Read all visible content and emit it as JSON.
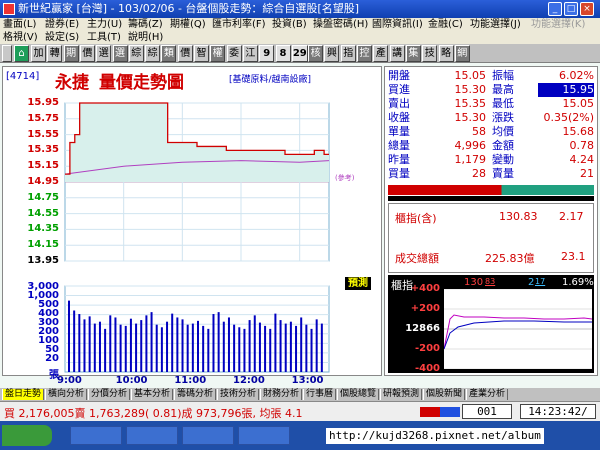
{
  "window": {
    "title": "新世紀贏家 [台灣] - 103/02/06 - 台盤個股走勢：綜合自選股[名望股]",
    "min": "_",
    "max": "□",
    "close": "×"
  },
  "menu": {
    "row1": [
      {
        "label": "畫面(L)",
        "enabled": true
      },
      {
        "label": "證券(E)",
        "enabled": true
      },
      {
        "label": "主力(U)",
        "enabled": true
      },
      {
        "label": "籌碼(Z)",
        "enabled": true
      },
      {
        "label": "期權(Q)",
        "enabled": true
      },
      {
        "label": "匯市利率(F)",
        "enabled": true
      },
      {
        "label": "投資(B)",
        "enabled": true
      },
      {
        "label": "操盤密碼(H)",
        "enabled": true
      },
      {
        "label": "國際資訊(I)",
        "enabled": true
      },
      {
        "label": "金融(C)",
        "enabled": true
      },
      {
        "label": "功能選擇(J)",
        "enabled": true
      },
      {
        "label": "功能選擇(K)",
        "enabled": false
      }
    ],
    "row2": [
      {
        "label": "格視(V)"
      },
      {
        "label": "設定(S)"
      },
      {
        "label": "工具(T)"
      },
      {
        "label": "說明(H)"
      }
    ]
  },
  "toolbar": {
    "home_icon": "home-icon",
    "buttons": [
      "加",
      "轉",
      "期",
      "價",
      "選",
      "選",
      "綜",
      "綜",
      "類",
      "價",
      "智",
      "權",
      "委",
      "江",
      "9",
      "8",
      "29",
      "核",
      "興",
      "指",
      "控",
      "產",
      "講",
      "集",
      "技",
      "略",
      "網"
    ]
  },
  "stock": {
    "code": "[4714]",
    "name": "永捷",
    "chart_title": "量價走勢圖",
    "subtitle": "[基礎原料/越南設廠]"
  },
  "price_axis": {
    "ticks": [
      "15.95",
      "15.75",
      "15.55",
      "15.35",
      "15.15",
      "14.95",
      "14.75",
      "14.55",
      "14.35",
      "14.15",
      "13.95"
    ],
    "base_label": "(參考)"
  },
  "volume_axis": {
    "ticks": [
      "3,000",
      "1,000",
      "500",
      "400",
      "300",
      "200",
      "100",
      "50",
      "20"
    ],
    "unit": "張"
  },
  "time_axis": [
    "9:00",
    "10:00",
    "11:00",
    "12:00",
    "13:00"
  ],
  "predict_button": "預測",
  "quote": {
    "rows": [
      {
        "l1": "開盤",
        "v1": "15.05",
        "l2": "振幅",
        "v2": "6.02%",
        "c1": "#d00000",
        "c2": "#d00000"
      },
      {
        "l1": "買進",
        "v1": "15.30",
        "l2": "最高",
        "v2": "15.95",
        "c1": "#d00000",
        "c2": "#ffffff"
      },
      {
        "l1": "賣出",
        "v1": "15.35",
        "l2": "最低",
        "v2": "15.05",
        "c1": "#d00000",
        "c2": "#d00000"
      },
      {
        "l1": "收盤",
        "v1": "15.30",
        "l2": "漲跌",
        "v2": "0.35(2%)",
        "c1": "#d00000",
        "c2": "#d00000"
      },
      {
        "l1": "單量",
        "v1": "58",
        "l2": "均價",
        "v2": "15.68",
        "c1": "#d00000",
        "c2": "#d00000"
      },
      {
        "l1": "總量",
        "v1": "4,996",
        "l2": "金額",
        "v2": "0.78",
        "c1": "#d00000",
        "c2": "#d00000"
      },
      {
        "l1": "昨量",
        "v1": "1,179",
        "l2": "變動",
        "v2": "4.24",
        "c1": "#d00000",
        "c2": "#d00000"
      },
      {
        "l1": "買量",
        "v1": "28",
        "l2": "賣量",
        "v2": "21",
        "c1": "#d00000",
        "c2": "#d00000"
      }
    ],
    "high_highlight_color": "#0000c0"
  },
  "index_box": {
    "label": "櫃指(含)",
    "value": "130.83",
    "change": "2.17",
    "amount_label": "成交總額",
    "amount": "225.83億",
    "amount_change": "23.1"
  },
  "mini_chart": {
    "label": "櫃指",
    "value": "130",
    "value_sub": "83",
    "up_count": "2",
    "up_count_sub": "17",
    "pct": "1.69%",
    "ticks": [
      "+400",
      "+200",
      "12866",
      "-200",
      "-400"
    ]
  },
  "tabs": [
    {
      "label": "盤日走勢",
      "active": true
    },
    {
      "label": "橫向分析",
      "active": false
    },
    {
      "label": "分價分析",
      "active": false
    },
    {
      "label": "基本分析",
      "active": false
    },
    {
      "label": "籌碼分析",
      "active": false
    },
    {
      "label": "技術分析",
      "active": false
    },
    {
      "label": "財務分析",
      "active": false
    },
    {
      "label": "行事曆",
      "active": false
    },
    {
      "label": "個股總覽",
      "active": false
    },
    {
      "label": "研報預測",
      "active": false
    },
    {
      "label": "個股新聞",
      "active": false
    },
    {
      "label": "產業分析",
      "active": false
    }
  ],
  "status": {
    "text": "買 2,176,005賣 1,763,289( 0.81)成 973,796張, 均張 4.1",
    "page": "001",
    "time": "14:23:42/"
  },
  "taskbar": {
    "watermark": "http://kujd3268.pixnet.net/album"
  },
  "colors": {
    "price_line": "#d00000",
    "avg_line": "#b040c0",
    "fill": "#d8f0ec",
    "volume": "#0000c0",
    "grid": "#a0c8e0"
  },
  "chart_data": [
    {
      "type": "line",
      "title": "量價走勢圖",
      "series": [
        {
          "x": [
            "9:00",
            "9:05",
            "9:10",
            "9:15",
            "9:20",
            "9:30",
            "9:45",
            "10:00",
            "10:15",
            "10:30",
            "10:40",
            "10:45",
            "11:00",
            "11:15",
            "11:30",
            "11:45",
            "12:00",
            "12:15",
            "12:30",
            "12:45",
            "13:00",
            "13:15",
            "13:25",
            "13:30"
          ],
          "values": [
            15.05,
            15.45,
            15.55,
            15.95,
            15.95,
            15.95,
            15.95,
            15.95,
            15.95,
            15.95,
            15.95,
            15.45,
            15.45,
            15.4,
            15.4,
            15.35,
            15.35,
            15.35,
            15.35,
            15.3,
            15.3,
            15.35,
            15.3,
            15.3
          ]
        },
        {
          "x": [
            "9:00",
            "10:00",
            "11:00",
            "12:00",
            "13:00",
            "13:30"
          ],
          "values": [
            15.05,
            15.15,
            15.2,
            15.22,
            15.2,
            15.22
          ]
        }
      ],
      "ylim": [
        13.95,
        15.95
      ]
    },
    {
      "type": "bar",
      "values": [
        900,
        350,
        250,
        150,
        200,
        100,
        120,
        60,
        220,
        180,
        90,
        80,
        160,
        100,
        140,
        220,
        300,
        90,
        70,
        120,
        260,
        180,
        150,
        90,
        100,
        130,
        80,
        60,
        250,
        300,
        120,
        180,
        90,
        70,
        60,
        140,
        220,
        110,
        80,
        60,
        260,
        140,
        100,
        120,
        80,
        180,
        90,
        60,
        150,
        100
      ],
      "ylabel": "張",
      "ylim": [
        0,
        3000
      ]
    }
  ]
}
